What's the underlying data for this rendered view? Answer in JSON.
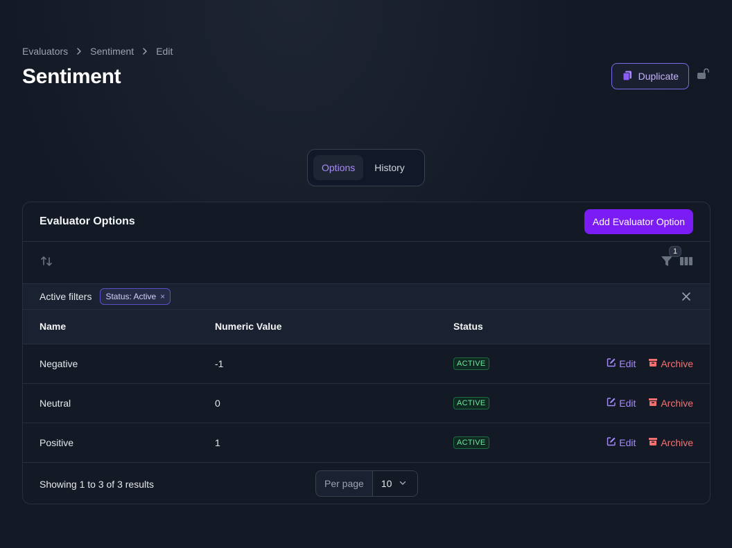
{
  "breadcrumb": [
    "Evaluators",
    "Sentiment",
    "Edit"
  ],
  "page_title": "Sentiment",
  "header_actions": {
    "duplicate_label": "Duplicate"
  },
  "tabs": [
    {
      "label": "Options",
      "active": true
    },
    {
      "label": "History",
      "active": false
    }
  ],
  "card": {
    "title": "Evaluator Options",
    "add_button_label": "Add Evaluator Option",
    "filter_count": "1",
    "active_filters_label": "Active filters",
    "filter_chip": "Status: Active",
    "filter_chip_remove": "×"
  },
  "table": {
    "columns": [
      "Name",
      "Numeric Value",
      "Status"
    ],
    "rows": [
      {
        "name": "Negative",
        "value": "-1",
        "status": "ACTIVE"
      },
      {
        "name": "Neutral",
        "value": "0",
        "status": "ACTIVE"
      },
      {
        "name": "Positive",
        "value": "1",
        "status": "ACTIVE"
      }
    ],
    "edit_label": "Edit",
    "archive_label": "Archive"
  },
  "footer": {
    "results_text": "Showing 1 to 3 of 3 results",
    "per_page_label": "Per page",
    "per_page_value": "10"
  },
  "colors": {
    "accent": "#7c1cf5",
    "link": "#a78bfa",
    "danger": "#f87171",
    "success": "#6ee7a0"
  }
}
